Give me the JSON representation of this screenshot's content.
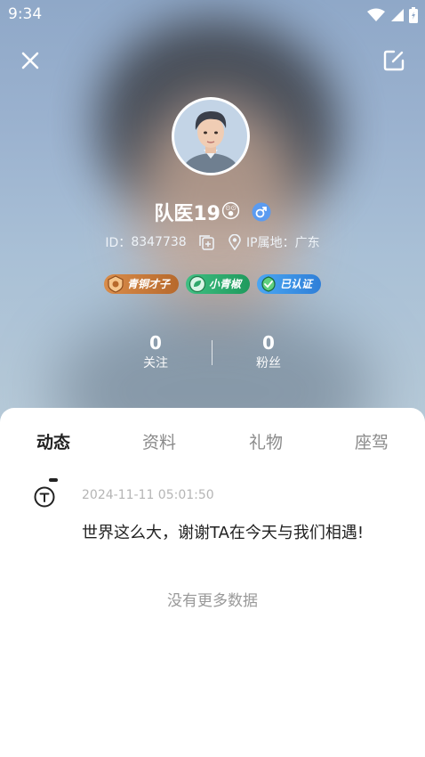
{
  "status_bar": {
    "time": "9:34"
  },
  "header": {
    "close_icon": "close-icon",
    "edit_icon": "edit-icon"
  },
  "profile": {
    "nickname": "队医19",
    "emoji": "😲",
    "gender": "male",
    "id_label": "ID：",
    "id_value": "8347738",
    "ip_label": "IP属地：",
    "ip_value": "广东"
  },
  "badges": [
    {
      "label": "青铜才子",
      "color": "#c9793a"
    },
    {
      "label": "小青椒",
      "color": "#2fa86b"
    },
    {
      "label": "已认证",
      "color": "#2f8de8"
    }
  ],
  "stats": {
    "following": {
      "value": "0",
      "label": "关注"
    },
    "followers": {
      "value": "0",
      "label": "粉丝"
    }
  },
  "tabs": [
    {
      "label": "动态",
      "active": true
    },
    {
      "label": "资料",
      "active": false
    },
    {
      "label": "礼物",
      "active": false
    },
    {
      "label": "座驾",
      "active": false
    }
  ],
  "posts": [
    {
      "time": "2024-11-11 05:01:50",
      "text": "世界这么大，谢谢TA在今天与我们相遇!"
    }
  ],
  "no_more_text": "没有更多数据",
  "colors": {
    "gender_male": "#5b9bf0",
    "active_tab": "#222222",
    "muted": "#999999"
  }
}
